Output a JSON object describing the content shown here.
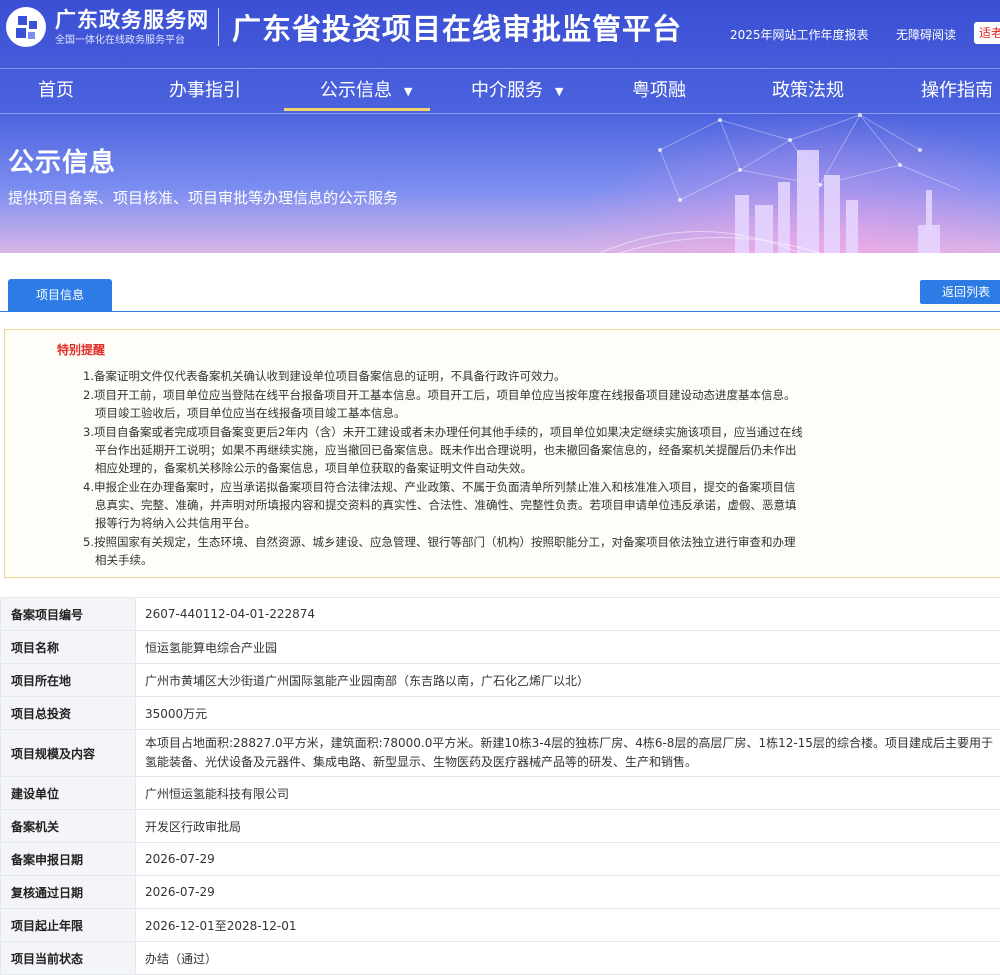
{
  "header": {
    "gov_portal_name": "广东政务服务网",
    "gov_portal_subtitle": "全国一体化在线政务服务平台",
    "platform_title": "广东省投资项目在线审批监管平台",
    "links": {
      "annual_report": "2025年网站工作年度报表",
      "accessibility": "无障碍阅读",
      "elder_mode": "适老"
    }
  },
  "nav": {
    "items": [
      {
        "label": "首页",
        "dropdown": false,
        "active": false
      },
      {
        "label": "办事指引",
        "dropdown": false,
        "active": false
      },
      {
        "label": "公示信息",
        "dropdown": true,
        "active": true
      },
      {
        "label": "中介服务",
        "dropdown": true,
        "active": false
      },
      {
        "label": "粤项融",
        "dropdown": false,
        "active": false
      },
      {
        "label": "政策法规",
        "dropdown": false,
        "active": false
      },
      {
        "label": "操作指南",
        "dropdown": false,
        "active": false
      }
    ]
  },
  "banner": {
    "title": "公示信息",
    "description": "提供项目备案、项目核准、项目审批等办理信息的公示服务"
  },
  "tabs": {
    "project_info": "项目信息",
    "back_to_list": "返回列表"
  },
  "notice": {
    "title": "特别提醒",
    "lines": [
      "1.备案证明文件仅代表备案机关确认收到建设单位项目备案信息的证明，不具备行政许可效力。",
      "2.项目开工前，项目单位应当登陆在线平台报备项目开工基本信息。项目开工后，项目单位应当按年度在线报备项目建设动态进度基本信息。",
      "项目竣工验收后，项目单位应当在线报备项目竣工基本信息。",
      "3.项目自备案或者完成项目备案变更后2年内（含）未开工建设或者未办理任何其他手续的，项目单位如果决定继续实施该项目，应当通过在线",
      "平台作出延期开工说明；如果不再继续实施，应当撤回已备案信息。既未作出合理说明，也未撤回备案信息的，经备案机关提醒后仍未作出",
      "相应处理的，备案机关移除公示的备案信息，项目单位获取的备案证明文件自动失效。",
      "4.申报企业在办理备案时，应当承诺拟备案项目符合法律法规、产业政策、不属于负面清单所列禁止准入和核准准入项目，提交的备案项目信",
      "息真实、完整、准确，并声明对所填报内容和提交资料的真实性、合法性、准确性、完整性负责。若项目申请单位违反承诺，虚假、恶意填",
      "报等行为将纳入公共信用平台。",
      "5.按照国家有关规定，生态环境、自然资源、城乡建设、应急管理、银行等部门（机构）按照职能分工，对备案项目依法独立进行审查和办理",
      "相关手续。"
    ]
  },
  "project": {
    "rows": [
      {
        "label": "备案项目编号",
        "value": "2607-440112-04-01-222874"
      },
      {
        "label": "项目名称",
        "value": "恒运氢能算电综合产业园"
      },
      {
        "label": "项目所在地",
        "value": "广州市黄埔区大沙街道广州国际氢能产业园南部（东吉路以南，广石化乙烯厂以北）"
      },
      {
        "label": "项目总投资",
        "value": "35000万元"
      },
      {
        "label": "项目规模及内容",
        "value": "本项目占地面积:28827.0平方米，建筑面积:78000.0平方米。新建10栋3-4层的独栋厂房、4栋6-8层的高层厂房、1栋12-15层的综合楼。项目建成后主要用于",
        "value_line2": "氢能装备、光伏设备及元器件、集成电路、新型显示、生物医药及医疗器械产品等的研发、生产和销售。"
      },
      {
        "label": "建设单位",
        "value": "广州恒运氢能科技有限公司"
      },
      {
        "label": "备案机关",
        "value": "开发区行政审批局"
      },
      {
        "label": "备案申报日期",
        "value": "2026-07-29"
      },
      {
        "label": "复核通过日期",
        "value": "2026-07-29"
      },
      {
        "label": "项目起止年限",
        "value": "2026-12-01至2028-12-01"
      },
      {
        "label": "项目当前状态",
        "value": "办结（通过）"
      }
    ]
  },
  "colors": {
    "primary": "#2d7be5",
    "nav_bg": "#4458d8",
    "nav_active_underline": "#f3d46a",
    "notice_title": "#e0302a",
    "notice_border": "#f0d29a"
  }
}
